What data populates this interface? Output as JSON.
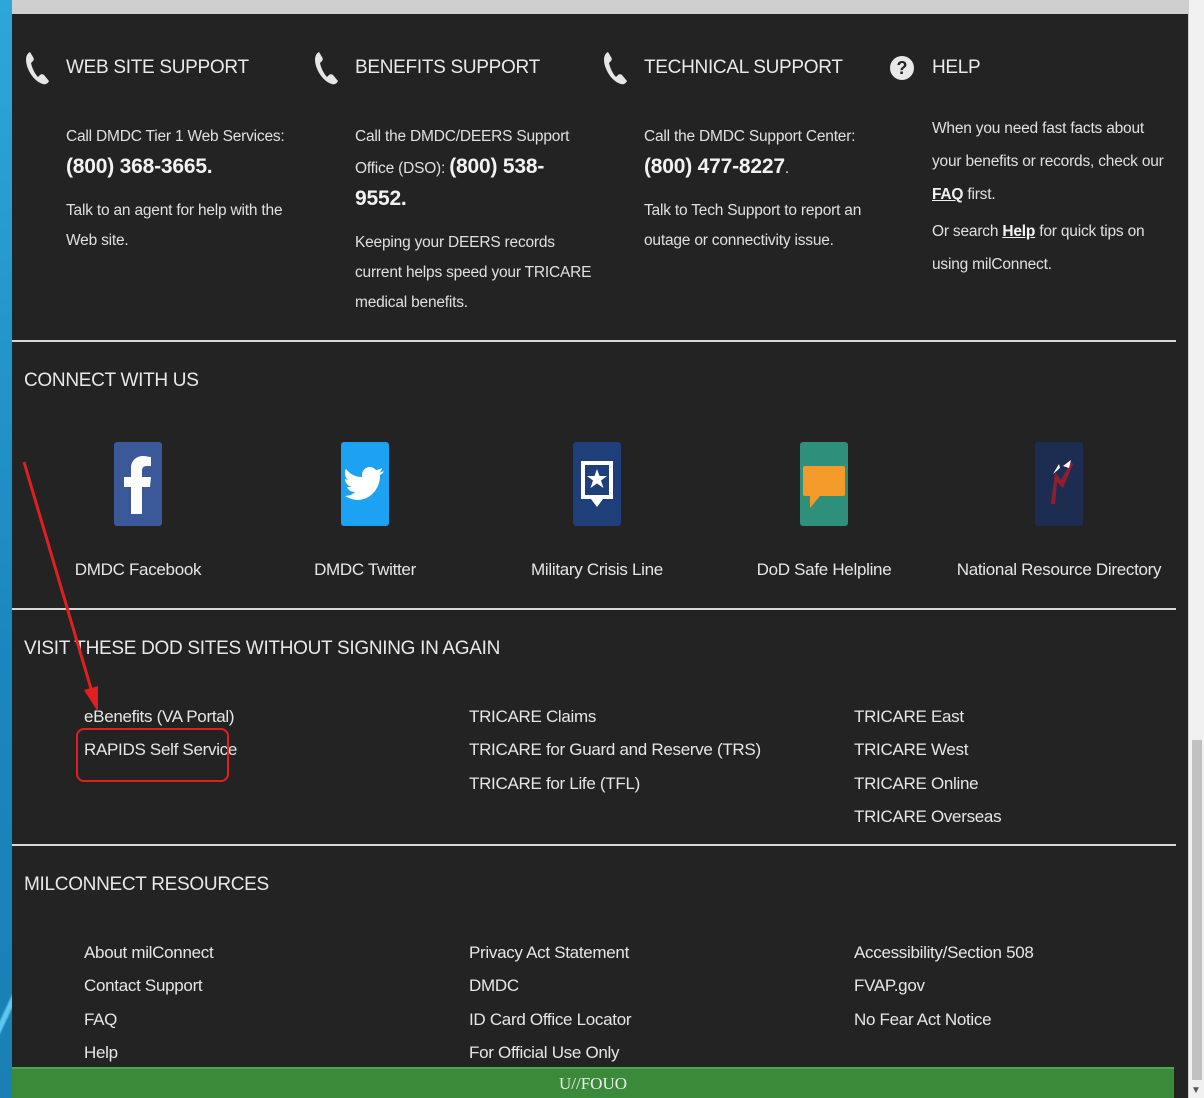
{
  "support": [
    {
      "icon": "phone-icon",
      "title": "WEB SITE SUPPORT",
      "p1_pre": "Call DMDC Tier 1 Web Services: ",
      "p1_big": "(800) 368-3665.",
      "p2": "Talk to an agent for help with the Web site."
    },
    {
      "icon": "phone-icon",
      "title": "BENEFITS SUPPORT",
      "p1_pre": "Call the DMDC/DEERS Support Office (DSO): ",
      "p1_big": "(800) 538-9552.",
      "p2": "Keeping your DEERS records current helps speed your TRICARE medical benefits."
    },
    {
      "icon": "phone-icon",
      "title": "TECHNICAL SUPPORT",
      "p1_pre": "Call the DMDC Support Center: ",
      "p1_big": "(800) 477-8227",
      "p1_post": ".",
      "p2": "Talk to Tech Support to report an outage or connectivity issue."
    },
    {
      "icon": "question-icon",
      "title": "HELP",
      "p1_pre": "When you need fast facts about your benefits or records, check our ",
      "p1_link": "FAQ",
      "p1_post": " first.",
      "p2_pre": "Or search ",
      "p2_link": "Help",
      "p2_post": " for quick tips on using milConnect."
    }
  ],
  "connect": {
    "title": "CONNECT WITH US",
    "items": [
      {
        "label": "DMDC Facebook",
        "icon": "facebook-icon",
        "color": "#3b5998"
      },
      {
        "label": "DMDC Twitter",
        "icon": "twitter-icon",
        "color": "#1da1f2"
      },
      {
        "label": "Military Crisis Line",
        "icon": "crisis-line-icon",
        "color": "#1f3f7a"
      },
      {
        "label": "DoD Safe Helpline",
        "icon": "safe-helpline-icon",
        "color": "#2e8f7a"
      },
      {
        "label": "National Resource Directory",
        "icon": "nrd-icon",
        "color": "#1d2d52"
      }
    ]
  },
  "dod_sites": {
    "title": "VISIT THESE DOD SITES WITHOUT SIGNING IN AGAIN",
    "col1": [
      "eBenefits (VA Portal)",
      "RAPIDS Self Service"
    ],
    "col2": [
      "TRICARE Claims",
      "TRICARE for Guard and Reserve (TRS)",
      "TRICARE for Life (TFL)"
    ],
    "col3": [
      "TRICARE East",
      "TRICARE West",
      "TRICARE Online",
      "TRICARE Overseas"
    ]
  },
  "resources": {
    "title": "MILCONNECT RESOURCES",
    "col1": [
      "About milConnect",
      "Contact Support",
      "FAQ",
      "Help"
    ],
    "col2": [
      "Privacy Act Statement",
      "DMDC",
      "ID Card Office Locator",
      "For Official Use Only"
    ],
    "col3": [
      "Accessibility/Section 508",
      "FVAP.gov",
      "No Fear Act Notice"
    ]
  },
  "footer": {
    "banner": "U//FOUO",
    "color": "#3a8a3a"
  },
  "annotation": {
    "color": "#e02020"
  }
}
